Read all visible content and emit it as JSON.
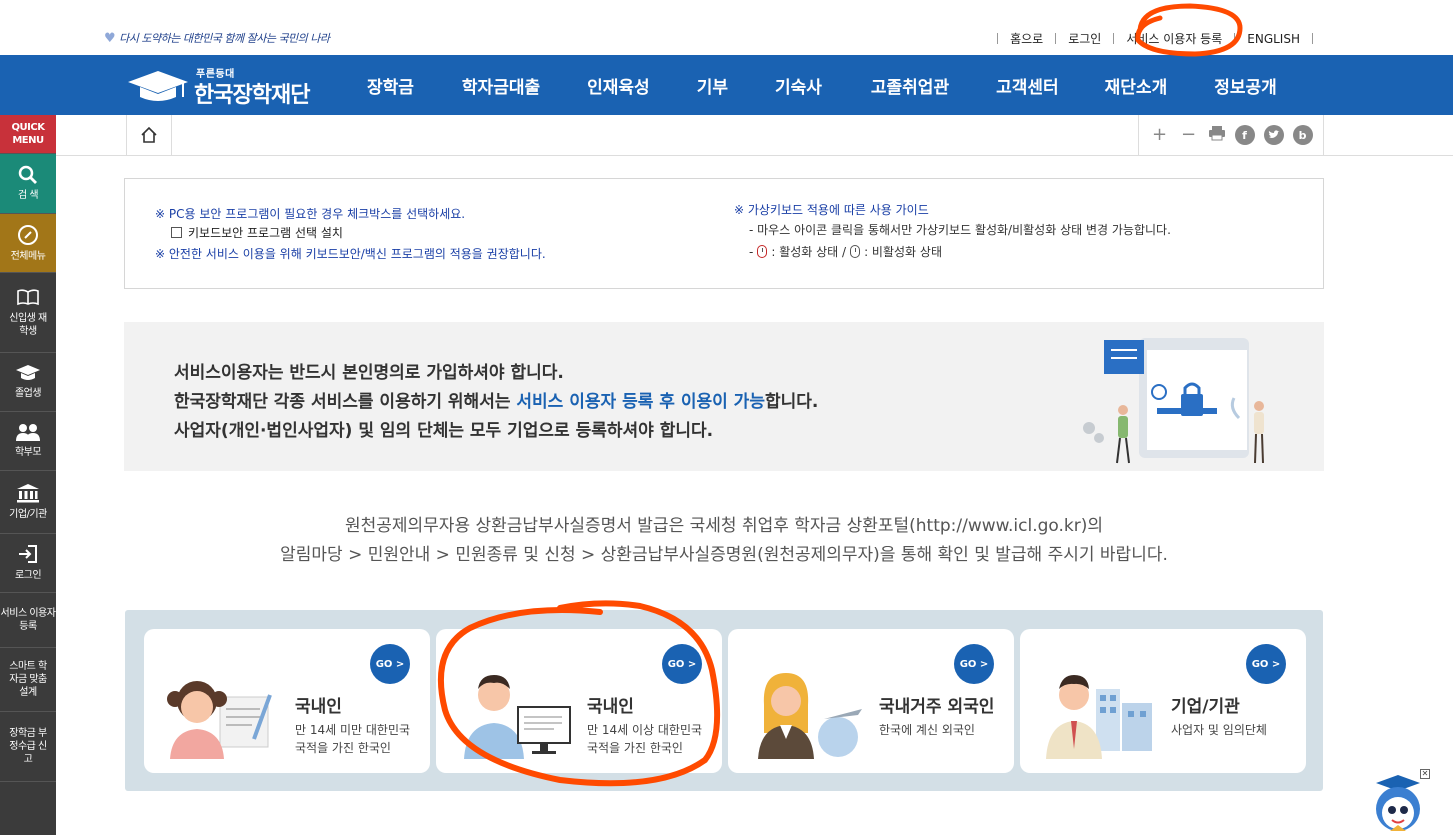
{
  "top": {
    "slogan": "다시 도약하는 대한민국 함께 잘사는 국민의 나라",
    "links": [
      "홈으로",
      "로그인",
      "서비스 이용자 등록",
      "ENGLISH"
    ]
  },
  "logo": {
    "sub": "푸른등대",
    "name": "한국장학재단"
  },
  "nav": [
    "장학금",
    "학자금대출",
    "인재육성",
    "기부",
    "기숙사",
    "고졸취업관",
    "고객센터",
    "재단소개",
    "정보공개"
  ],
  "quick": {
    "header": "QUICK MENU",
    "items": [
      {
        "label": "검 색",
        "icon": "search-icon"
      },
      {
        "label": "전체메뉴",
        "icon": "compass-icon"
      },
      {
        "label": "신입생 재학생",
        "icon": "book-icon"
      },
      {
        "label": "졸업생",
        "icon": "graduation-cap-icon"
      },
      {
        "label": "학부모",
        "icon": "people-icon"
      },
      {
        "label": "기업/기관",
        "icon": "institution-icon"
      },
      {
        "label": "로그인",
        "icon": "login-icon"
      },
      {
        "label": "서비스 이용자 등록",
        "icon": ""
      },
      {
        "label": "스마트 학자금 맞춤설계",
        "icon": ""
      },
      {
        "label": "장학금 부정수급 신고",
        "icon": ""
      }
    ],
    "colors": {
      "header": "#c8313a",
      "search": "#1b8a78",
      "menu": "#a27618",
      "default": "#3b3b3b"
    }
  },
  "toolbar": {
    "zoom_in": "+",
    "zoom_out": "−",
    "facebook": "f",
    "blog": "b"
  },
  "notice": {
    "left_line1": "※ PC용 보안 프로그램이 필요한 경우 체크박스를 선택하세요.",
    "checkbox_label": "키보드보안 프로그램 선택 설치",
    "left_line2": "※ 안전한 서비스 이용을 위해 키보드보안/백신 프로그램의 적용을 권장합니다.",
    "right_title": "※ 가상키보드 적용에 따른 사용 가이드",
    "right_line1": "- 마우스 아이콘 클릭을 통해서만 가상키보드 활성화/비활성화 상태 변경 가능합니다.",
    "right_line2_prefix": "-",
    "active_label": ": 활성화 상태 /",
    "inactive_label": ": 비활성화 상태"
  },
  "banner": {
    "line1": "서비스이용자는 반드시 본인명의로 가입하셔야 합니다.",
    "line2_pre": "한국장학재단 각종 서비스를 이용하기 위해서는 ",
    "line2_hl": "서비스 이용자 등록 후 이용이 가능",
    "line2_post": "합니다.",
    "line3": "사업자(개인·법인사업자) 및 임의 단체는 모두 기업으로 등록하셔야 합니다."
  },
  "icl": {
    "line1": "원천공제의무자용 상환금납부사실증명서 발급은 국세청 취업후 학자금 상환포털(http://www.icl.go.kr)의",
    "line2": "알림마당 > 민원안내 > 민원종류 및 신청 > 상환금납부사실증명원(원천공제의무자)을 통해 확인 및 발급해 주시기 바랍니다."
  },
  "cards": [
    {
      "title": "국내인",
      "desc1": "만 14세 미만 대한민국",
      "desc2": "국적을 가진 한국인",
      "go": "GO >"
    },
    {
      "title": "국내인",
      "desc1": "만 14세 이상 대한민국",
      "desc2": "국적을 가진 한국인",
      "go": "GO >"
    },
    {
      "title": "국내거주 외국인",
      "desc1": "한국에 계신 외국인",
      "desc2": "",
      "go": "GO >"
    },
    {
      "title": "기업/기관",
      "desc1": "사업자 및 임의단체",
      "desc2": "",
      "go": "GO >"
    }
  ],
  "colors": {
    "brand": "#1a62b2",
    "annotation": "#ff4a00",
    "link_blue": "#1a3fa6"
  }
}
